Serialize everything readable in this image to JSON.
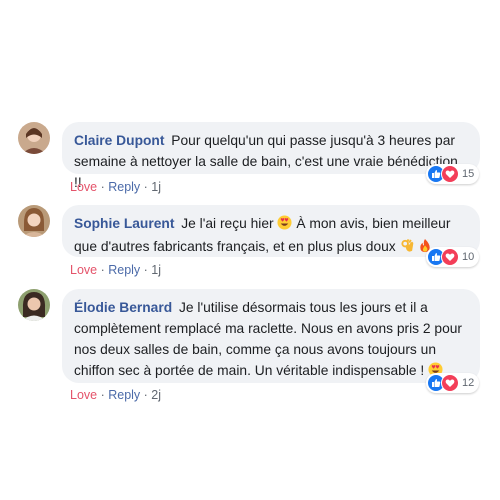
{
  "comments": [
    {
      "author": "Claire Dupont",
      "text": "Pour quelqu'un qui passe jusqu'à 3 heures par semaine à nettoyer la salle de bain, c'est une vraie bénédiction !!",
      "love": "Love",
      "reply": "Reply",
      "time": "1j",
      "reaction_count": "15",
      "avatar_icon": "profile-photo"
    },
    {
      "author": "Sophie Laurent",
      "text_before": "Je l'ai reçu hier",
      "emoji1": "heart-eyes-emoji",
      "text_after": "À mon avis, bien meilleur que d'autres fabricants français, et en plus plus doux",
      "emoji2": "ok-hand-emoji",
      "emoji3": "fire-emoji",
      "love": "Love",
      "reply": "Reply",
      "time": "1j",
      "reaction_count": "10",
      "avatar_icon": "profile-photo"
    },
    {
      "author": "Élodie Bernard",
      "text": "Je l'utilise désormais tous les jours et il a complètement remplacé ma raclette. Nous en avons pris 2 pour nos deux salles de bain, comme ça nous avons toujours un chiffon sec à portée de main. Un véritable indispensable !",
      "emoji": "heart-eyes-emoji",
      "love": "Love",
      "reply": "Reply",
      "time": "2j",
      "reaction_count": "12",
      "avatar_icon": "profile-photo"
    }
  ],
  "colors": {
    "author": "#385898",
    "love": "#e4536a",
    "bubble": "#f0f2f5",
    "like": "#1877f2",
    "heart": "#f33e58"
  }
}
